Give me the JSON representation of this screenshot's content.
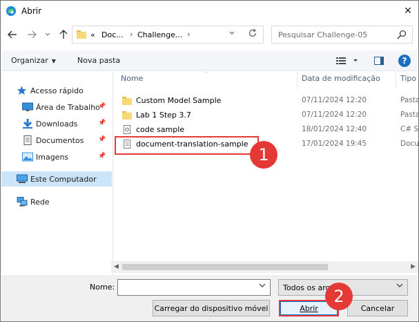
{
  "window": {
    "title": "Abrir",
    "close_label": "✕"
  },
  "address": {
    "segments": [
      "Doc...",
      "Challenge..."
    ],
    "overflow": "«",
    "search_placeholder": "Pesquisar Challenge-05"
  },
  "toolbar": {
    "organize_label": "Organizar",
    "new_folder_label": "Nova pasta",
    "help_label": "?"
  },
  "nav": {
    "items": [
      {
        "label": "Acesso rápido",
        "icon": "star-icon"
      },
      {
        "label": "Área de Trabalho",
        "icon": "desktop-icon",
        "pinned": true
      },
      {
        "label": "Downloads",
        "icon": "download-icon",
        "pinned": true
      },
      {
        "label": "Documentos",
        "icon": "documents-icon",
        "pinned": true
      },
      {
        "label": "Imagens",
        "icon": "images-icon",
        "pinned": true
      },
      {
        "label": "Este Computador",
        "icon": "computer-icon",
        "selected": true
      },
      {
        "label": "Rede",
        "icon": "network-icon"
      }
    ]
  },
  "columns": {
    "name": "Nome",
    "date": "Data de modificação",
    "type": "Tipo"
  },
  "files": [
    {
      "name": "Custom Model Sample",
      "date": "07/11/2024 12:20",
      "type": "Pasta",
      "icon": "folder-icon"
    },
    {
      "name": "Lab 1 Step 3.7",
      "date": "07/11/2024 12:20",
      "type": "Pasta",
      "icon": "folder-icon"
    },
    {
      "name": "code sample",
      "date": "18/01/2024 12:40",
      "type": "C# So",
      "icon": "code-file-icon"
    },
    {
      "name": "document-translation-sample",
      "date": "17/01/2024 19:45",
      "type": "Docu",
      "icon": "document-file-icon"
    }
  ],
  "annotations": {
    "step1": "1",
    "step2": "2"
  },
  "footer": {
    "name_label": "Nome:",
    "name_value": "",
    "filter_value": "Todos os arqu",
    "upload_button": "Carregar do dispositivo móvel",
    "open_button": "Abrir",
    "cancel_button": "Cancelar"
  },
  "colors": {
    "accent": "#0078d7",
    "annotation": "#e53935",
    "folder": "#f8d775",
    "selection": "#cce4f7"
  }
}
